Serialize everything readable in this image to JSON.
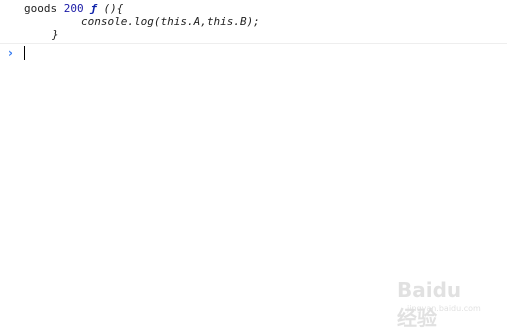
{
  "console": {
    "log_entry": {
      "label": "goods",
      "number": "200",
      "fn_keyword": "ƒ",
      "signature": "(){",
      "body_line": "console.log(this.A,this.B);",
      "closing": "}"
    },
    "prompt": {
      "symbol": "›",
      "value": ""
    }
  },
  "watermark": {
    "logo": "Baidu 经验",
    "sub": "jingyan.baidu.com"
  },
  "colors": {
    "number": "#1a1aa6",
    "fn_keyword": "#0d22aa",
    "prompt": "#367cf1"
  }
}
